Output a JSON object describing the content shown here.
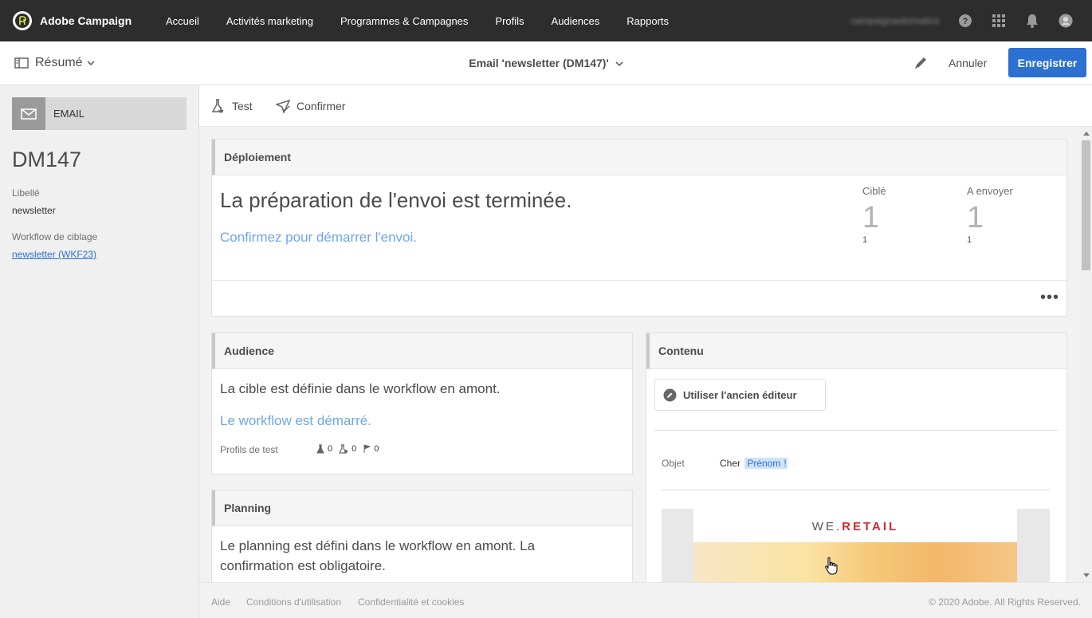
{
  "app": {
    "name": "Adobe Campaign",
    "nav": [
      "Accueil",
      "Activités marketing",
      "Programmes & Campagnes",
      "Profils",
      "Audiences",
      "Rapports"
    ],
    "user_label": "campaignautomatica"
  },
  "header": {
    "view_label": "Résumé",
    "title": "Email 'newsletter (DM147)'",
    "cancel_label": "Annuler",
    "save_label": "Enregistrer"
  },
  "sidebar": {
    "type_label": "EMAIL",
    "code": "DM147",
    "label_title": "Libellé",
    "label_value": "newsletter",
    "workflow_title": "Workflow de ciblage",
    "workflow_link": "newsletter (WKF23)"
  },
  "actions": {
    "test_label": "Test",
    "confirm_label": "Confirmer"
  },
  "deployment": {
    "title": "Déploiement",
    "message": "La préparation de l'envoi est terminée.",
    "link": "Confirmez pour démarrer l'envoi.",
    "targeted_label": "Ciblé",
    "targeted_value": "1",
    "targeted_sub": "1",
    "to_send_label": "A envoyer",
    "to_send_value": "1",
    "to_send_sub": "1",
    "more": "•••"
  },
  "audience": {
    "title": "Audience",
    "text": "La cible est définie dans le workflow en amont.",
    "link": "Le workflow est démarré.",
    "test_profiles_label": "Profils de test",
    "count_test": "0",
    "count_seed": "0",
    "count_flag": "0"
  },
  "planning": {
    "title": "Planning",
    "text": "Le planning est défini dans le workflow en amont. La confirmation est obligatoire."
  },
  "content": {
    "title": "Contenu",
    "old_editor_label": "Utiliser l'ancien éditeur",
    "subject_label": "Objet",
    "subject_prefix": "Cher",
    "subject_field": "Prénom",
    "subject_suffix": "!",
    "preview_logo_a": "WE.",
    "preview_logo_b": "RETAIL"
  },
  "footer": {
    "help": "Aide",
    "terms": "Conditions d'utilisation",
    "privacy": "Confidentialité et cookies",
    "copyright": "© 2020 Adobe. All Rights Reserved."
  },
  "colors": {
    "primary": "#2c70d2",
    "link": "#6ea6ec",
    "topbar": "#2d2d2d",
    "accent_red": "#d8262f"
  }
}
